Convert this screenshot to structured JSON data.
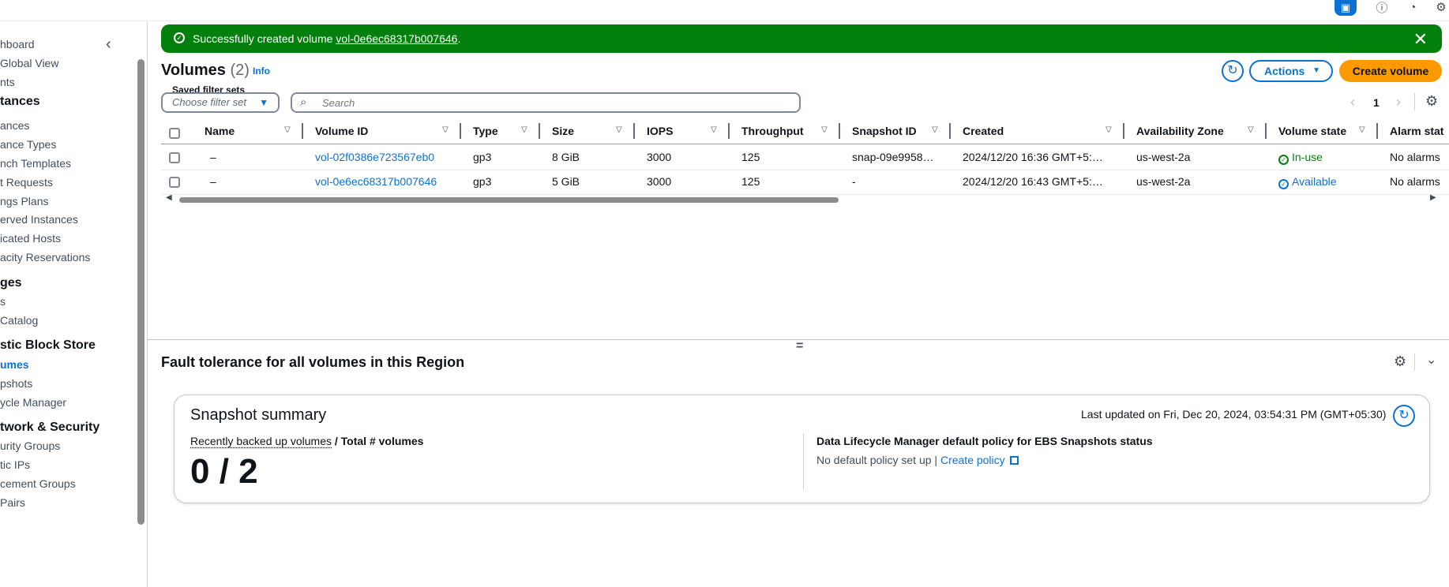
{
  "topbar": {
    "icons": [
      "cloudshell-icon",
      "info-icon",
      "notifications-icon",
      "settings-icon"
    ]
  },
  "sidebar": {
    "items": [
      {
        "label": "hboard",
        "kind": "item"
      },
      {
        "label": " Global View",
        "kind": "item"
      },
      {
        "label": "nts",
        "kind": "item"
      },
      {
        "label": "tances",
        "kind": "head"
      },
      {
        "label": "ances",
        "kind": "item"
      },
      {
        "label": "ance Types",
        "kind": "item"
      },
      {
        "label": "nch Templates",
        "kind": "item"
      },
      {
        "label": "t Requests",
        "kind": "item"
      },
      {
        "label": "ngs Plans",
        "kind": "item"
      },
      {
        "label": "erved Instances",
        "kind": "item"
      },
      {
        "label": "icated Hosts",
        "kind": "item"
      },
      {
        "label": "acity Reservations",
        "kind": "item"
      },
      {
        "label": "ges",
        "kind": "head"
      },
      {
        "label": "s",
        "kind": "item"
      },
      {
        "label": " Catalog",
        "kind": "item"
      },
      {
        "label": "stic Block Store",
        "kind": "head"
      },
      {
        "label": "umes",
        "kind": "active"
      },
      {
        "label": "pshots",
        "kind": "item"
      },
      {
        "label": "ycle Manager",
        "kind": "item"
      },
      {
        "label": "twork & Security",
        "kind": "head"
      },
      {
        "label": "urity Groups",
        "kind": "item"
      },
      {
        "label": "tic IPs",
        "kind": "item"
      },
      {
        "label": "cement Groups",
        "kind": "item"
      },
      {
        "label": " Pairs",
        "kind": "item"
      }
    ]
  },
  "flash": {
    "prefix": "Successfully created volume ",
    "volume_link": "vol-0e6ec68317b007646",
    "suffix": ".",
    "color": "#037f0c"
  },
  "header": {
    "title": "Volumes",
    "count": "(2)",
    "info": "Info",
    "actions": "Actions",
    "create": "Create volume"
  },
  "filters": {
    "saved_label": "Saved filter sets",
    "saved_placeholder": "Choose filter set",
    "search_placeholder": "Search"
  },
  "pagination": {
    "page": "1"
  },
  "table": {
    "columns": [
      "Name",
      "Volume ID",
      "Type",
      "Size",
      "IOPS",
      "Throughput",
      "Snapshot ID",
      "Created",
      "Availability Zone",
      "Volume state",
      "Alarm stat"
    ],
    "rows": [
      {
        "name": "–",
        "volume_id": "vol-02f0386e723567eb0",
        "type": "gp3",
        "size": "8 GiB",
        "iops": "3000",
        "throughput": "125",
        "snapshot_id": "snap-09e9958…",
        "created": "2024/12/20 16:36 GMT+5:…",
        "az": "us-west-2a",
        "state": "In-use",
        "alarm": "No alarms"
      },
      {
        "name": "–",
        "volume_id": "vol-0e6ec68317b007646",
        "type": "gp3",
        "size": "5 GiB",
        "iops": "3000",
        "throughput": "125",
        "snapshot_id": "-",
        "created": "2024/12/20 16:43 GMT+5:…",
        "az": "us-west-2a",
        "state": "Available",
        "alarm": "No alarms"
      }
    ]
  },
  "fault": {
    "title": "Fault tolerance for all volumes in this Region"
  },
  "snapshot_summary": {
    "title": "Snapshot summary",
    "updated": "Last updated on Fri, Dec 20, 2024, 03:54:31 PM (GMT+05:30)",
    "label_link": "Recently backed up volumes",
    "label_rest": " / Total # volumes",
    "value": "0 / 2",
    "dlm_title": "Data Lifecycle Manager default policy for EBS Snapshots status",
    "dlm_status": "No default policy set up | ",
    "dlm_link": "Create policy"
  },
  "colors": {
    "link": "#0972d3",
    "primary_button": "#ff9900",
    "success": "#037f0c"
  }
}
